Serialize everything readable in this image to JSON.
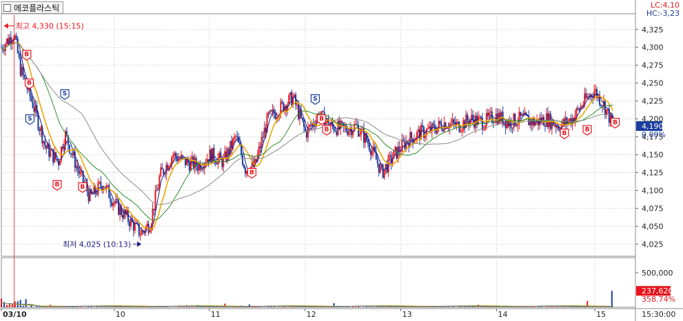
{
  "title": "에코플라스틱",
  "lc_label": "LC:4,10",
  "hc_label": "HC:-3,23",
  "price_axis": {
    "ticks": [
      {
        "v": 4325,
        "label": "4,325"
      },
      {
        "v": 4300,
        "label": "4,300"
      },
      {
        "v": 4275,
        "label": "4,275"
      },
      {
        "v": 4250,
        "label": "4,250"
      },
      {
        "v": 4225,
        "label": "4,225"
      },
      {
        "v": 4200,
        "label": "4,200"
      },
      {
        "v": 4175,
        "label": "4,175"
      },
      {
        "v": 4150,
        "label": "4,150"
      },
      {
        "v": 4125,
        "label": "4,125"
      },
      {
        "v": 4100,
        "label": "4,100"
      },
      {
        "v": 4075,
        "label": "4,075"
      },
      {
        "v": 4050,
        "label": "4,050"
      },
      {
        "v": 4025,
        "label": "4,025"
      }
    ],
    "current": {
      "v": 4190,
      "label": "4,190"
    },
    "pct_label": "0.00%",
    "min": 4008,
    "max": 4345
  },
  "volume_axis": {
    "ticks": [
      {
        "v": 500000,
        "label": "500,000"
      }
    ],
    "current": {
      "v": 237620,
      "label": "237,620"
    },
    "pct_label": "358.74%",
    "max": 700000
  },
  "x_labels": [
    {
      "t": 0,
      "label": "03/10"
    },
    {
      "t": 0.178,
      "label": "10"
    },
    {
      "t": 0.328,
      "label": "11"
    },
    {
      "t": 0.479,
      "label": "12"
    },
    {
      "t": 0.63,
      "label": "13"
    },
    {
      "t": 0.781,
      "label": "14"
    },
    {
      "t": 0.936,
      "label": "15"
    }
  ],
  "time_label": "15:30:00",
  "annotations": {
    "high": {
      "label": "최고 4,330 (15:15)",
      "t": 0.004,
      "v": 4330
    },
    "low": {
      "label": "최저 4,025 (10:13)",
      "t": 0.224,
      "v": 4025
    }
  },
  "colors": {
    "up": "#e8141c",
    "down": "#1a3d9e",
    "ma1": "#1c1c84",
    "ma2": "#e9a600",
    "ma3": "#2d8a2d",
    "ma4": "#8a8a8a"
  },
  "chart_data": {
    "type": "candlestick",
    "x_range": [
      0,
      1
    ],
    "price_series": {
      "description": "approximate price path (0..1 across the session range)",
      "x": [
        0,
        0.02,
        0.03,
        0.05,
        0.07,
        0.09,
        0.1,
        0.12,
        0.14,
        0.16,
        0.18,
        0.2,
        0.22,
        0.235,
        0.25,
        0.27,
        0.29,
        0.31,
        0.33,
        0.35,
        0.37,
        0.385,
        0.4,
        0.42,
        0.44,
        0.46,
        0.48,
        0.5,
        0.52,
        0.54,
        0.56,
        0.58,
        0.6,
        0.62,
        0.64,
        0.66,
        0.68,
        0.7,
        0.72,
        0.74,
        0.76,
        0.78,
        0.8,
        0.82,
        0.84,
        0.86,
        0.88,
        0.9,
        0.92,
        0.935,
        0.95,
        0.96,
        0.965
      ],
      "close": [
        4300,
        4320,
        4270,
        4220,
        4160,
        4140,
        4180,
        4130,
        4090,
        4110,
        4080,
        4060,
        4040,
        4055,
        4120,
        4150,
        4140,
        4135,
        4150,
        4140,
        4175,
        4130,
        4135,
        4200,
        4215,
        4230,
        4180,
        4205,
        4190,
        4185,
        4190,
        4165,
        4125,
        4150,
        4170,
        4180,
        4185,
        4195,
        4190,
        4200,
        4195,
        4205,
        4195,
        4200,
        4195,
        4200,
        4190,
        4200,
        4225,
        4240,
        4220,
        4200,
        4190
      ]
    },
    "signals": [
      {
        "type": "B",
        "t": 0.04,
        "v": 4290
      },
      {
        "type": "B",
        "t": 0.044,
        "v": 4250
      },
      {
        "type": "S",
        "t": 0.1,
        "v": 4235
      },
      {
        "type": "S",
        "t": 0.045,
        "v": 4200
      },
      {
        "type": "B",
        "t": 0.088,
        "v": 4108
      },
      {
        "type": "B",
        "t": 0.128,
        "v": 4105
      },
      {
        "type": "B",
        "t": 0.395,
        "v": 4125
      },
      {
        "type": "S",
        "t": 0.495,
        "v": 4228
      },
      {
        "type": "B",
        "t": 0.505,
        "v": 4200
      },
      {
        "type": "B",
        "t": 0.513,
        "v": 4185
      },
      {
        "type": "B",
        "t": 0.888,
        "v": 4180
      },
      {
        "type": "B",
        "t": 0.924,
        "v": 4185
      },
      {
        "type": "B",
        "t": 0.968,
        "v": 4195
      }
    ],
    "volume": {
      "peak": 160000,
      "last": 237620,
      "ylim": [
        0,
        700000
      ]
    }
  }
}
